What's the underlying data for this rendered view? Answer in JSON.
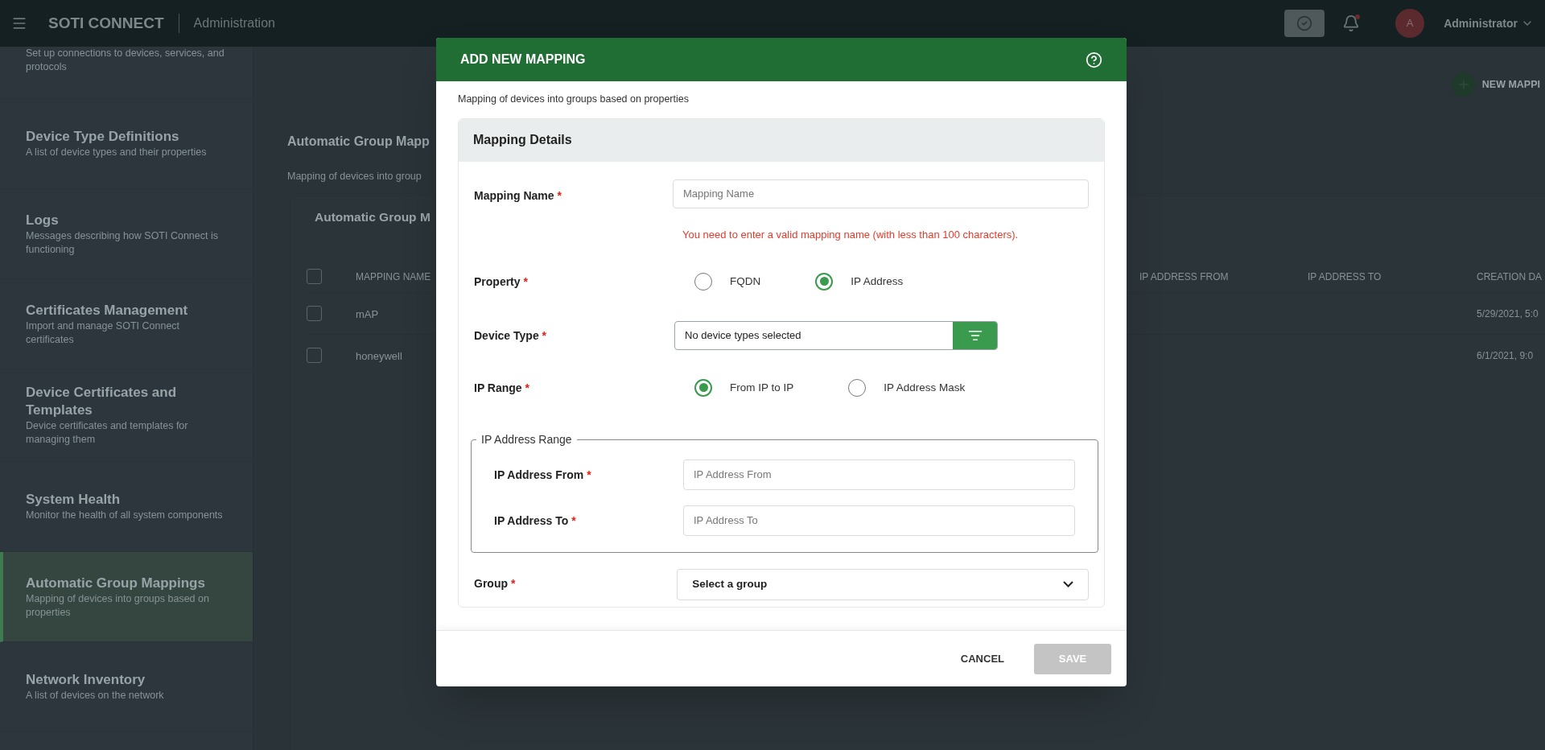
{
  "app_bar": {
    "brand": "SOTI CONNECT",
    "section": "Administration",
    "user_initial": "A",
    "user_name": "Administrator"
  },
  "sidebar": {
    "items": [
      {
        "description": "Set up connections to devices, services, and protocols",
        "selected": false
      },
      {
        "title": "Device Type Definitions",
        "description": "A list of device types and their properties",
        "selected": false
      },
      {
        "title": "Logs",
        "description": "Messages describing how SOTI Connect is functioning",
        "selected": false
      },
      {
        "title": "Certificates Management",
        "description": "Import and manage SOTI Connect certificates",
        "selected": false
      },
      {
        "title": "Device Certificates and Templates",
        "description": "Device certificates and templates for managing them",
        "selected": false
      },
      {
        "title": "System Health",
        "description": "Monitor the health of all system components",
        "selected": false
      },
      {
        "title": "Automatic Group Mappings",
        "description": "Mapping of devices into groups based on properties",
        "selected": true
      },
      {
        "title": "Network Inventory",
        "description": "A list of devices on the network",
        "selected": false
      }
    ]
  },
  "page": {
    "title": "Automatic Group Mapp",
    "subtitle": "Mapping of devices into group",
    "new_button": "NEW MAPPI",
    "table": {
      "title": "Automatic Group M",
      "header_checked": false,
      "columns": [
        "MAPPING NAME",
        "IP ADDRESS FROM",
        "IP ADDRESS TO",
        "CREATION DA"
      ],
      "rows": [
        {
          "checked": false,
          "mapping_name": "mAP",
          "creation_date": "5/29/2021, 5:0"
        },
        {
          "checked": false,
          "mapping_name": "honeywell",
          "creation_date": "6/1/2021, 9:0"
        }
      ]
    }
  },
  "dialog": {
    "title": "ADD NEW MAPPING",
    "description": "Mapping of devices into groups based on properties",
    "section_title": "Mapping Details",
    "fields": [
      {
        "kind": "text",
        "label": "Mapping Name",
        "required_mark": "*",
        "placeholder": "Mapping Name",
        "error": "You need to enter a valid mapping name (with less than 100 characters)."
      },
      {
        "kind": "radio",
        "label": "Property",
        "required_mark": "*",
        "options": [
          {
            "label": "FQDN",
            "selected": false
          },
          {
            "label": "IP Address",
            "selected": true
          }
        ]
      },
      {
        "kind": "filter",
        "label": "Device Type",
        "required_mark": "*",
        "value": "No device types selected"
      },
      {
        "kind": "radio",
        "label": "IP Range",
        "required_mark": "*",
        "options": [
          {
            "label": "From IP to IP",
            "selected": true
          },
          {
            "label": "IP Address Mask",
            "selected": false
          }
        ]
      },
      {
        "kind": "fieldset",
        "legend": "IP Address Range",
        "fields": [
          {
            "label": "IP Address From",
            "required_mark": "*",
            "placeholder": "IP Address From"
          },
          {
            "label": "IP Address To",
            "required_mark": "*",
            "placeholder": "IP Address To"
          }
        ]
      },
      {
        "kind": "select",
        "label": "Group",
        "required_mark": "*",
        "value": "Select a group"
      }
    ],
    "cancel": "CANCEL",
    "save": {
      "label": "SAVE",
      "disabled": true
    }
  }
}
